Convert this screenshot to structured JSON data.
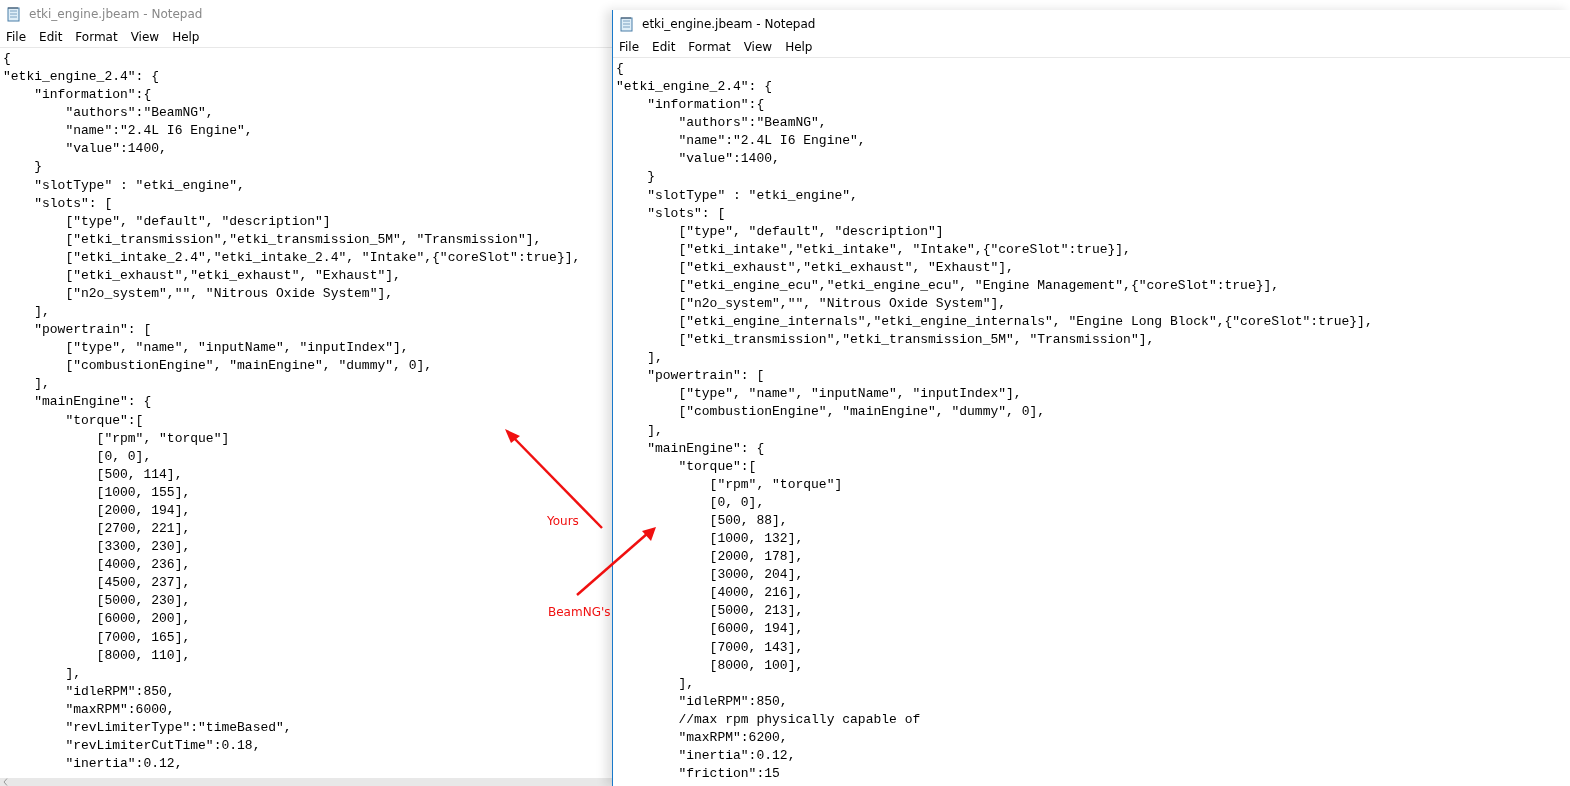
{
  "windows": [
    {
      "title": "etki_engine.jbeam - Notepad",
      "active": false,
      "menu": [
        "File",
        "Edit",
        "Format",
        "View",
        "Help"
      ],
      "lines": [
        "{",
        "\"etki_engine_2.4\": {",
        "    \"information\":{",
        "        \"authors\":\"BeamNG\",",
        "        \"name\":\"2.4L I6 Engine\",",
        "        \"value\":1400,",
        "    }",
        "    \"slotType\" : \"etki_engine\",",
        "    \"slots\": [",
        "        [\"type\", \"default\", \"description\"]",
        "        [\"etki_transmission\",\"etki_transmission_5M\", \"Transmission\"],",
        "        [\"etki_intake_2.4\",\"etki_intake_2.4\", \"Intake\",{\"coreSlot\":true}],",
        "        [\"etki_exhaust\",\"etki_exhaust\", \"Exhaust\"],",
        "        [\"n2o_system\",\"\", \"Nitrous Oxide System\"],",
        "    ],",
        "    \"powertrain\": [",
        "        [\"type\", \"name\", \"inputName\", \"inputIndex\"],",
        "        [\"combustionEngine\", \"mainEngine\", \"dummy\", 0],",
        "    ],",
        "    \"mainEngine\": {",
        "        \"torque\":[",
        "            [\"rpm\", \"torque\"]",
        "            [0, 0],",
        "            [500, 114],",
        "            [1000, 155],",
        "            [2000, 194],",
        "            [2700, 221],",
        "            [3300, 230],",
        "            [4000, 236],",
        "            [4500, 237],",
        "            [5000, 230],",
        "            [6000, 200],",
        "            [7000, 165],",
        "            [8000, 110],",
        "        ],",
        "        \"idleRPM\":850,",
        "        \"maxRPM\":6000,",
        "        \"revLimiterType\":\"timeBased\",",
        "        \"revLimiterCutTime\":0.18,",
        "        \"inertia\":0.12,"
      ],
      "hscroll": true
    },
    {
      "title": "etki_engine.jbeam - Notepad",
      "active": true,
      "menu": [
        "File",
        "Edit",
        "Format",
        "View",
        "Help"
      ],
      "lines": [
        "{",
        "\"etki_engine_2.4\": {",
        "    \"information\":{",
        "        \"authors\":\"BeamNG\",",
        "        \"name\":\"2.4L I6 Engine\",",
        "        \"value\":1400,",
        "    }",
        "    \"slotType\" : \"etki_engine\",",
        "    \"slots\": [",
        "        [\"type\", \"default\", \"description\"]",
        "        [\"etki_intake\",\"etki_intake\", \"Intake\",{\"coreSlot\":true}],",
        "        [\"etki_exhaust\",\"etki_exhaust\", \"Exhaust\"],",
        "        [\"etki_engine_ecu\",\"etki_engine_ecu\", \"Engine Management\",{\"coreSlot\":true}],",
        "        [\"n2o_system\",\"\", \"Nitrous Oxide System\"],",
        "        [\"etki_engine_internals\",\"etki_engine_internals\", \"Engine Long Block\",{\"coreSlot\":true}],",
        "        [\"etki_transmission\",\"etki_transmission_5M\", \"Transmission\"],",
        "    ],",
        "    \"powertrain\": [",
        "        [\"type\", \"name\", \"inputName\", \"inputIndex\"],",
        "        [\"combustionEngine\", \"mainEngine\", \"dummy\", 0],",
        "    ],",
        "    \"mainEngine\": {",
        "        \"torque\":[",
        "            [\"rpm\", \"torque\"]",
        "            [0, 0],",
        "            [500, 88],",
        "            [1000, 132],",
        "            [2000, 178],",
        "            [3000, 204],",
        "            [4000, 216],",
        "            [5000, 213],",
        "            [6000, 194],",
        "            [7000, 143],",
        "            [8000, 100],",
        "        ],",
        "        \"idleRPM\":850,",
        "        //max rpm physically capable of",
        "        \"maxRPM\":6200,",
        "        \"inertia\":0.12,",
        "        \"friction\":15"
      ],
      "hscroll": false
    }
  ],
  "annotations": [
    {
      "label": "Yours"
    },
    {
      "label": "BeamNG's"
    }
  ]
}
